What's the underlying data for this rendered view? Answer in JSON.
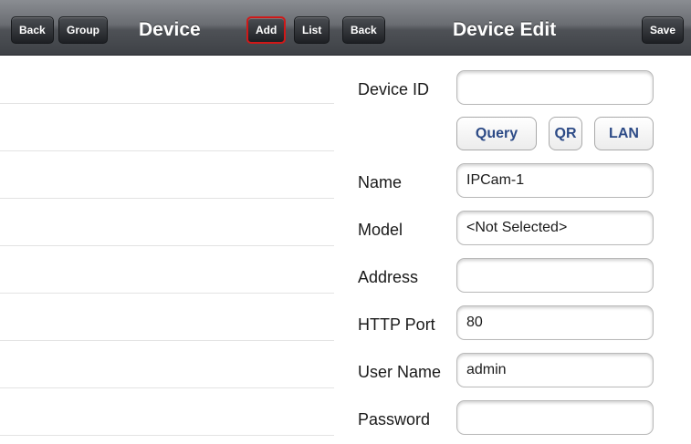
{
  "left": {
    "navbar": {
      "back_label": "Back",
      "group_label": "Group",
      "title": "Device",
      "add_label": "Add",
      "list_label": "List"
    },
    "rows": [
      "",
      "",
      "",
      "",
      "",
      "",
      "",
      ""
    ]
  },
  "right": {
    "navbar": {
      "back_label": "Back",
      "title": "Device Edit",
      "save_label": "Save"
    },
    "form": {
      "device_id": {
        "label": "Device ID",
        "value": ""
      },
      "buttons": {
        "query": "Query",
        "qr": "QR",
        "lan": "LAN"
      },
      "name": {
        "label": "Name",
        "value": "IPCam-1"
      },
      "model": {
        "label": "Model",
        "value": "<Not Selected>"
      },
      "address": {
        "label": "Address",
        "value": ""
      },
      "http_port": {
        "label": "HTTP Port",
        "value": "80"
      },
      "user_name": {
        "label": "User Name",
        "value": "admin"
      },
      "password": {
        "label": "Password",
        "value": ""
      }
    }
  },
  "colors": {
    "navbar": "#5a5d62",
    "button_dark": "#1e2024",
    "selected_outline": "#d01818",
    "link_blue": "#2c4a86"
  }
}
